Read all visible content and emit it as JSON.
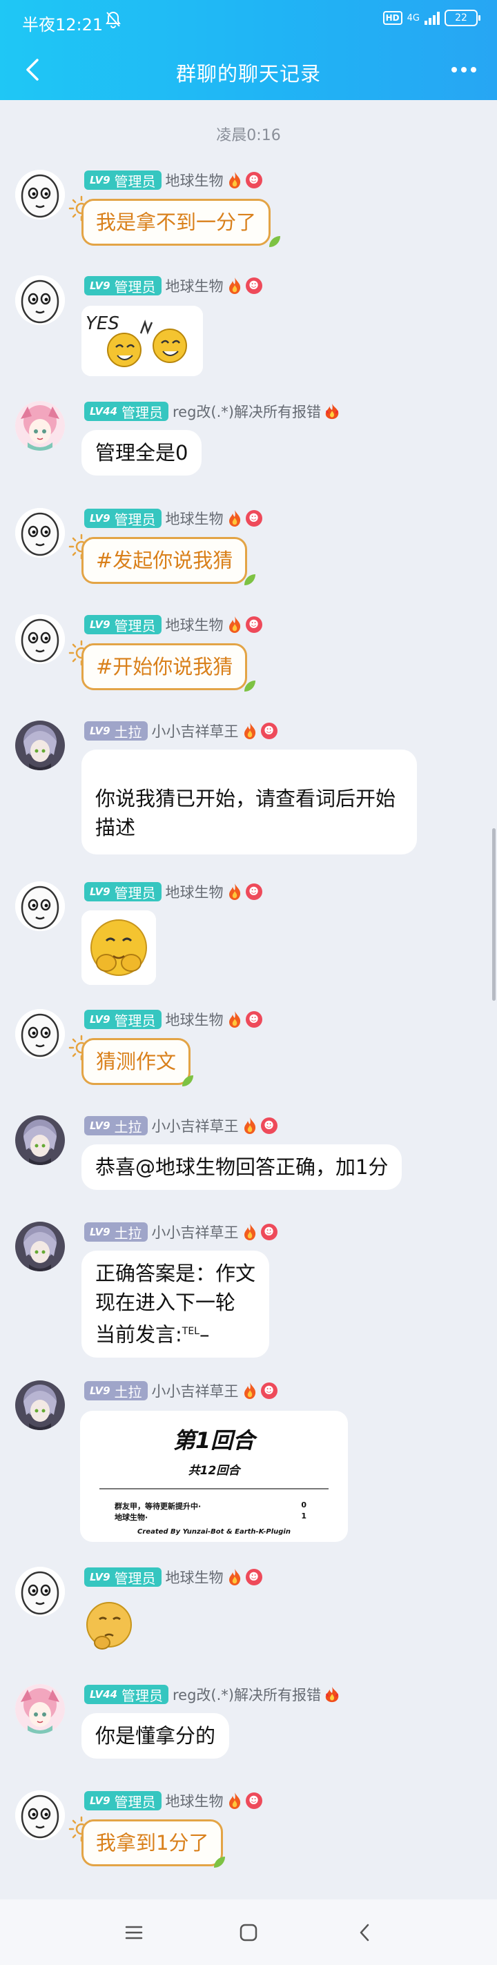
{
  "status": {
    "time": "半夜12:21",
    "net_label": "4G",
    "hd_label": "HD",
    "battery": "22"
  },
  "header": {
    "title": "群聊的聊天记录"
  },
  "timestamp": "凌晨0:16",
  "messages": [
    {
      "sender": "地球生物",
      "level": "LV9",
      "role": "管理员",
      "text": "我是拿不到一分了"
    },
    {
      "sender": "地球生物",
      "level": "LV9",
      "role": "管理员",
      "sticker": "yes-laughing-faces-sticker"
    },
    {
      "sender": "reg改(.*)解决所有报错",
      "level": "LV44",
      "role": "管理员",
      "text": "管理全是0"
    },
    {
      "sender": "地球生物",
      "level": "LV9",
      "role": "管理员",
      "text": "#发起你说我猜"
    },
    {
      "sender": "地球生物",
      "level": "LV9",
      "role": "管理员",
      "text": "#开始你说我猜"
    },
    {
      "sender": "小小吉祥草王",
      "level": "LV9",
      "role": "土拉",
      "text": "你说我猜已开始，请查看词后开始描述"
    },
    {
      "sender": "地球生物",
      "level": "LV9",
      "role": "管理员",
      "sticker": "covering-face-emoji-sticker"
    },
    {
      "sender": "地球生物",
      "level": "LV9",
      "role": "管理员",
      "text": "猜测作文"
    },
    {
      "sender": "小小吉祥草王",
      "level": "LV9",
      "role": "土拉",
      "text": "恭喜@地球生物回答正确，加1分"
    },
    {
      "sender": "小小吉祥草王",
      "level": "LV9",
      "role": "土拉",
      "text_lines": [
        "正确答案是：作文",
        "现在进入下一轮",
        "当前发言:"
      ],
      "tel_sup": "TEL",
      "tel_tail": "–"
    },
    {
      "sender": "小小吉祥草王",
      "level": "LV9",
      "role": "土拉",
      "card": {
        "title": "第1回合",
        "subtitle": "共12回合",
        "rows": [
          {
            "name": "群友甲，等待更新提升中·",
            "score": "0"
          },
          {
            "name": "地球生物·",
            "score": "1"
          }
        ],
        "footer": "Created By Yunzai-Bot & Earth-K-Plugin"
      }
    },
    {
      "sender": "地球生物",
      "level": "LV9",
      "role": "管理员",
      "sticker": "thinking-emoji-sticker"
    },
    {
      "sender": "reg改(.*)解决所有报错",
      "level": "LV44",
      "role": "管理员",
      "text": "你是懂拿分的"
    },
    {
      "sender": "地球生物",
      "level": "LV9",
      "role": "管理员",
      "text": "我拿到1分了"
    }
  ],
  "colors": {
    "accent": "#20b4f5",
    "admin_badge": "#36c6c0",
    "member_badge": "#9fa5c9",
    "gold_bubble": "#e3a446"
  }
}
